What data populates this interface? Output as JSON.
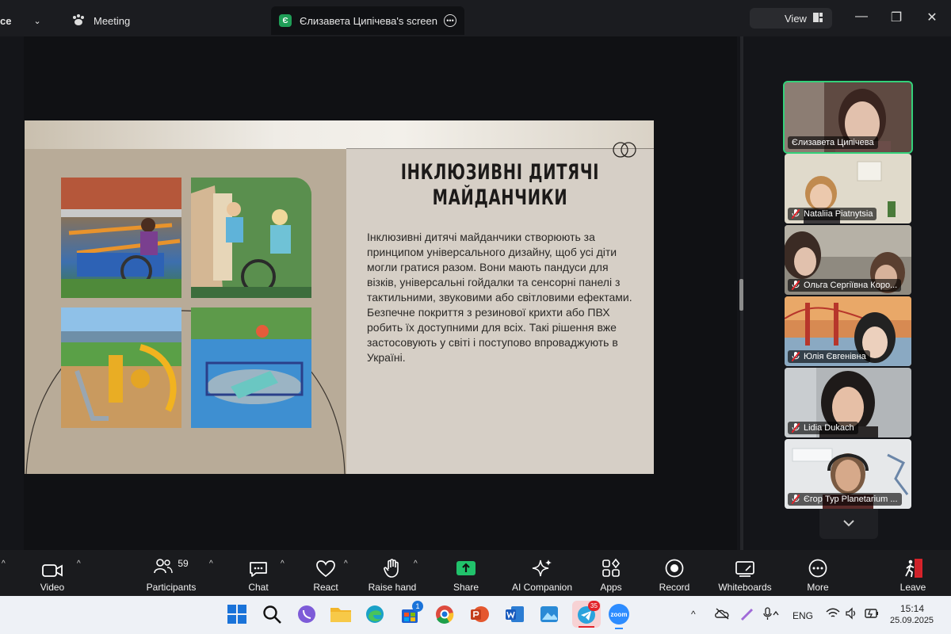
{
  "window": {
    "tabs": [
      {
        "label": "ce"
      },
      {
        "label": "Meeting"
      },
      {
        "label": "Єлизавета Ципічева's screen",
        "initial": "Є"
      }
    ],
    "view_label": "View"
  },
  "slide": {
    "title_line1": "ІНКЛЮЗИВНІ ДИТЯЧІ",
    "title_line2": "МАЙДАНЧИКИ",
    "body": "Інклюзивні дитячі майданчики створюють за принципом універсального дизайну, щоб усі діти могли гратися разом. Вони мають пандуси для візків, універсальні гойдалки та сенсорні панелі з тактильними, звуковими або світловими ефектами. Безпечне покриття з резинової крихти або ПВХ робить їх доступними для всіх. Такі рішення вже застосовують у світі і поступово впроваджують в Україні."
  },
  "participants": [
    {
      "name": "Єлизавета Ципічева",
      "muted": false,
      "active": true,
      "bg": "#7b6a62"
    },
    {
      "name": "Nataliia Piatnytsia",
      "muted": true,
      "active": false,
      "bg": "#d8d2c4"
    },
    {
      "name": "Ольга Сергіївна Коро...",
      "muted": true,
      "active": false,
      "bg": "#8a8478"
    },
    {
      "name": "Юлія Євгенівна",
      "muted": true,
      "active": false,
      "bg": "#c87a4a"
    },
    {
      "name": "Lidia Dukach",
      "muted": true,
      "active": false,
      "bg": "#a9aeb2"
    },
    {
      "name": "Єгор Тур Planetarium ...",
      "muted": true,
      "active": false,
      "bg": "#e6e8ea"
    }
  ],
  "toolbar": {
    "video": "Video",
    "participants": "Participants",
    "participants_count": "59",
    "chat": "Chat",
    "react": "React",
    "raise_hand": "Raise hand",
    "share": "Share",
    "ai_companion": "AI Companion",
    "apps": "Apps",
    "record": "Record",
    "whiteboards": "Whiteboards",
    "more": "More",
    "leave": "Leave"
  },
  "taskbar": {
    "store_badge": "1",
    "telegram_badge": "35",
    "zoom_label": "zoom",
    "language": "ENG",
    "time": "15:14",
    "date": "25.09.2025"
  },
  "colors": {
    "accent_green": "#1f9e57",
    "share_green": "#21c26b",
    "leave_red": "#e2242b",
    "active_border": "#34d17a"
  }
}
